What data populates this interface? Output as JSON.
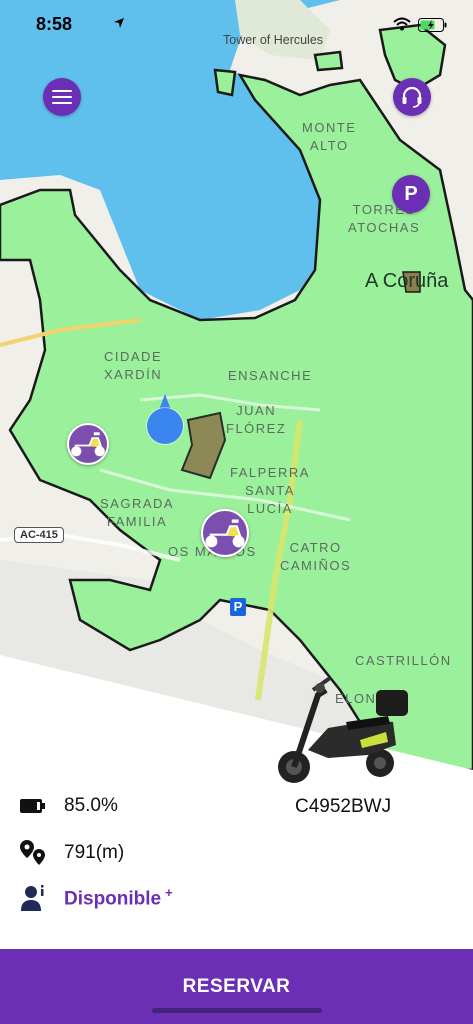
{
  "status_bar": {
    "time": "8:58"
  },
  "map": {
    "landmark": "Tower of Hercules",
    "city": "A Coruña",
    "road_shield": "AC-415",
    "parking_sign": "P",
    "neighborhoods": {
      "monte_alto": "MONTE\nALTO",
      "torres_atochas": "TORRES\nATOCHAS",
      "cidade_xardin": "CIDADE\nXARDÍN",
      "ensanche": "ENSANCHE",
      "juan_florez": "JUAN\nFLÓREZ",
      "falperra_santa_lucia": "FALPERRA\nSANTA\nLUCÍA",
      "sagrada_familia": "SAGRADA\nFAMILIA",
      "os_mallos": "OS MALLOS",
      "catro_caminos": "CATRO\nCAMIÑOS",
      "castrillon": "CASTRILLÓN",
      "elonelo": "ELONELO"
    },
    "parking_button": "P",
    "colors": {
      "zone": "#9bf09b",
      "zone_border": "#1a1a1a",
      "water": "#5fc0ee",
      "land": "#f0efe9",
      "no_parking": "#8c7e50"
    }
  },
  "scooter": {
    "battery": "85.0%",
    "distance": "791(m)",
    "plate": "C4952BWJ",
    "status": "Disponible",
    "status_suffix": "+"
  },
  "reserve_button": "RESERVAR",
  "accent_color": "#6a2fb4"
}
